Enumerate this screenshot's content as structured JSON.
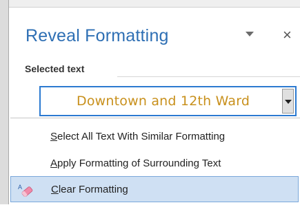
{
  "pane": {
    "title": "Reveal Formatting",
    "close_glyph": "×",
    "dropdown_icon": "chevron-down-icon"
  },
  "section": {
    "label": "Selected text"
  },
  "selected": {
    "text": "Downtown and 12th Ward",
    "text_color": "#c8901c",
    "border_color": "#2b79d0"
  },
  "menu": {
    "items": [
      {
        "mnemonic": "S",
        "rest": "elect All Text With Similar Formatting"
      },
      {
        "mnemonic": "A",
        "rest": "pply Formatting of Surrounding Text"
      },
      {
        "mnemonic": "C",
        "rest": "lear Formatting",
        "icon": "eraser-icon",
        "highlighted": true
      }
    ]
  }
}
